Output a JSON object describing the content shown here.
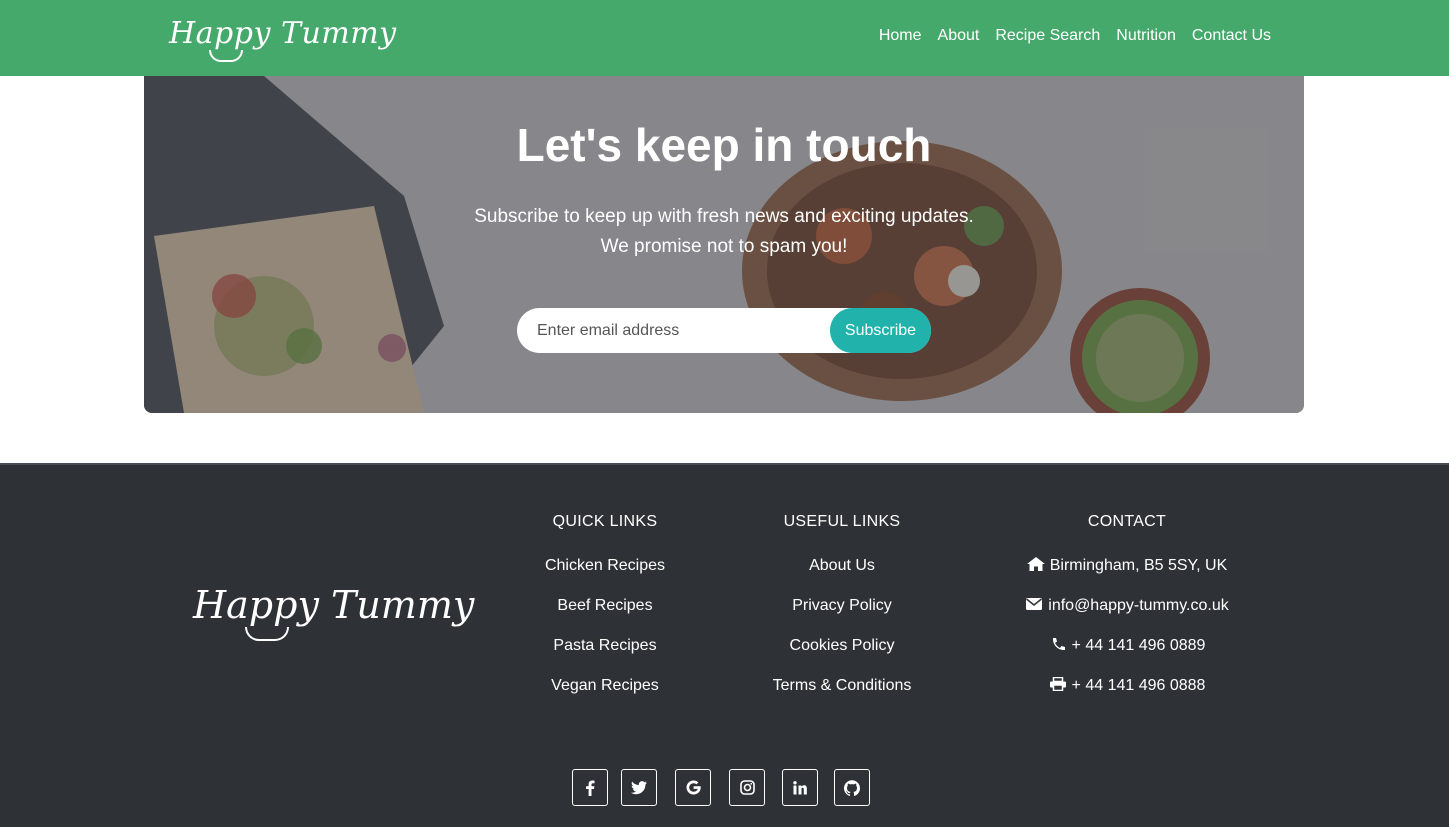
{
  "brand": {
    "name": "Happy Tummy"
  },
  "nav": {
    "items": [
      {
        "label": "Home"
      },
      {
        "label": "About"
      },
      {
        "label": "Recipe Search"
      },
      {
        "label": "Nutrition"
      },
      {
        "label": "Contact Us"
      }
    ]
  },
  "hero": {
    "title": "Let's keep in touch",
    "subtitle_line1": "Subscribe to keep up with fresh news and exciting updates.",
    "subtitle_line2": "We promise not to spam you!",
    "email_placeholder": "Enter email address",
    "email_value": "",
    "subscribe_label": "Subscribe"
  },
  "footer": {
    "brand_name": "Happy Tummy",
    "quick_links": {
      "heading": "QUICK LINKS",
      "items": [
        "Chicken Recipes",
        "Beef Recipes",
        "Pasta Recipes",
        "Vegan Recipes"
      ]
    },
    "useful_links": {
      "heading": "USEFUL LINKS",
      "items": [
        "About Us",
        "Privacy Policy",
        "Cookies Policy",
        "Terms & Conditions"
      ]
    },
    "contact": {
      "heading": "CONTACT",
      "address": "Birmingham, B5 5SY, UK",
      "email": "info@happy-tummy.co.uk",
      "phone": "+ 44 141 496 0889",
      "fax": "+ 44 141 496 0888"
    },
    "socials": [
      {
        "icon": "facebook-icon"
      },
      {
        "icon": "twitter-icon"
      },
      {
        "icon": "google-icon"
      },
      {
        "icon": "instagram-icon"
      },
      {
        "icon": "linkedin-icon"
      },
      {
        "icon": "github-icon"
      }
    ]
  },
  "colors": {
    "navbar": "#46a96c",
    "footer": "#2e3236",
    "accent": "#20b2ab"
  }
}
